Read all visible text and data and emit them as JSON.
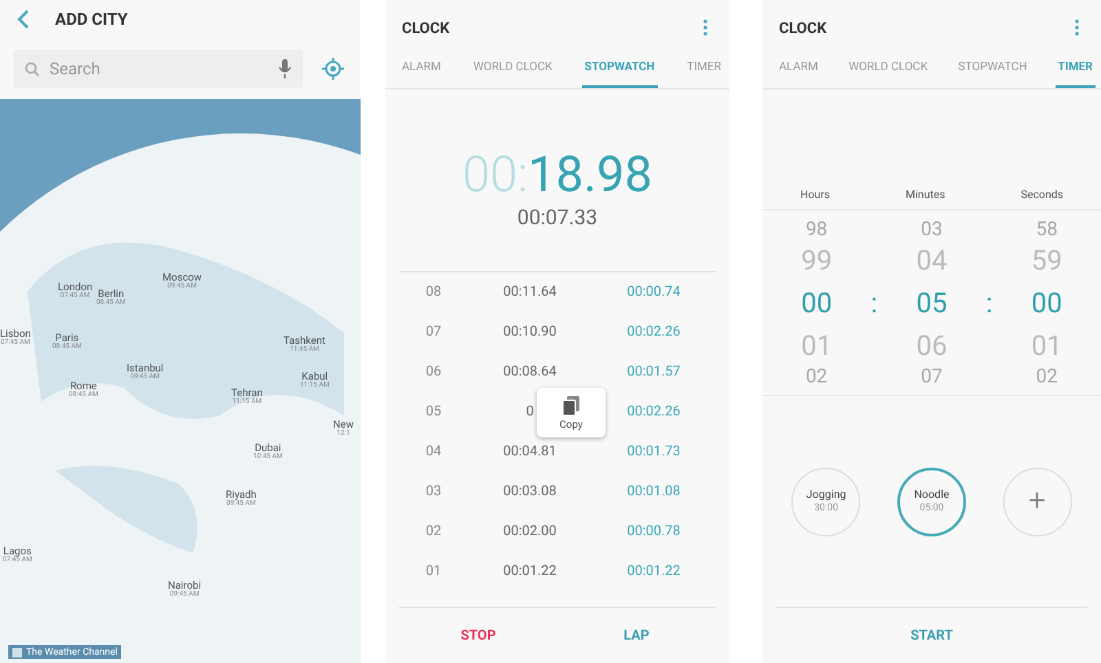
{
  "add_city": {
    "title": "ADD CITY",
    "search": {
      "placeholder": "Search"
    },
    "cities": [
      {
        "name": "London",
        "time": "07:45 AM"
      },
      {
        "name": "Berlin",
        "time": "08:45 AM"
      },
      {
        "name": "Moscow",
        "time": "09:45 AM"
      },
      {
        "name": "Lisbon",
        "time": "07:45 AM"
      },
      {
        "name": "Paris",
        "time": "08:45 AM"
      },
      {
        "name": "Istanbul",
        "time": "09:45 AM"
      },
      {
        "name": "Rome",
        "time": "08:45 AM"
      },
      {
        "name": "Tashkent",
        "time": "11:45 AM"
      },
      {
        "name": "Kabul",
        "time": "11:15 AM"
      },
      {
        "name": "Tehran",
        "time": "11:15 AM"
      },
      {
        "name": "New",
        "time": "12:1"
      },
      {
        "name": "Dubai",
        "time": "10:45 AM"
      },
      {
        "name": "Riyadh",
        "time": "09:45 AM"
      },
      {
        "name": "Lagos",
        "time": "07:45 AM"
      },
      {
        "name": "Nairobi",
        "time": "09:45 AM"
      }
    ],
    "credit": "The Weather Channel"
  },
  "stopwatch_screen": {
    "title": "CLOCK",
    "tabs": [
      {
        "label": "ALARM",
        "selected": false
      },
      {
        "label": "WORLD CLOCK",
        "selected": false
      },
      {
        "label": "STOPWATCH",
        "selected": true
      },
      {
        "label": "TIMER",
        "selected": false
      }
    ],
    "main_minutes": "00:",
    "main_seconds": "18.98",
    "lap_time": "00:07.33",
    "laps": [
      {
        "number": "08",
        "total": "00:11.64",
        "split": "00:00.74"
      },
      {
        "number": "07",
        "total": "00:10.90",
        "split": "00:02.26"
      },
      {
        "number": "06",
        "total": "00:08.64",
        "split": "00:01.57"
      },
      {
        "number": "05",
        "total": "0",
        "split": "00:02.26"
      },
      {
        "number": "04",
        "total": "00:04.81",
        "split": "00:01.73"
      },
      {
        "number": "03",
        "total": "00:03.08",
        "split": "00:01.08"
      },
      {
        "number": "02",
        "total": "00:02.00",
        "split": "00:00.78"
      },
      {
        "number": "01",
        "total": "00:01.22",
        "split": "00:01.22"
      }
    ],
    "popup": {
      "label": "Copy"
    },
    "buttons": [
      {
        "label": "STOP",
        "kind": "stop"
      },
      {
        "label": "LAP",
        "kind": "lap"
      }
    ]
  },
  "timer_screen": {
    "title": "CLOCK",
    "tabs": [
      {
        "label": "ALARM",
        "selected": false
      },
      {
        "label": "WORLD CLOCK",
        "selected": false
      },
      {
        "label": "STOPWATCH",
        "selected": false
      },
      {
        "label": "TIMER",
        "selected": true
      }
    ],
    "columns": [
      {
        "label": "Hours",
        "values": [
          {
            "text": "98",
            "selected": false
          },
          {
            "text": "99",
            "selected": false
          },
          {
            "text": "00",
            "selected": true
          },
          {
            "text": "01",
            "selected": false
          },
          {
            "text": "02",
            "selected": false
          }
        ]
      },
      {
        "label": "Minutes",
        "values": [
          {
            "text": "03",
            "selected": false
          },
          {
            "text": "04",
            "selected": false
          },
          {
            "text": "05",
            "selected": true
          },
          {
            "text": "06",
            "selected": false
          },
          {
            "text": "07",
            "selected": false
          }
        ]
      },
      {
        "label": "Seconds",
        "values": [
          {
            "text": "58",
            "selected": false
          },
          {
            "text": "59",
            "selected": false
          },
          {
            "text": "00",
            "selected": true
          },
          {
            "text": "01",
            "selected": false
          },
          {
            "text": "02",
            "selected": false
          }
        ]
      }
    ],
    "separator": ":",
    "presets": [
      {
        "kind": "preset",
        "name": "Jogging",
        "time": "30:00",
        "selected": false
      },
      {
        "kind": "preset",
        "name": "Noodle",
        "time": "05:00",
        "selected": true
      },
      {
        "kind": "add",
        "label": "+"
      }
    ],
    "start": "START"
  }
}
